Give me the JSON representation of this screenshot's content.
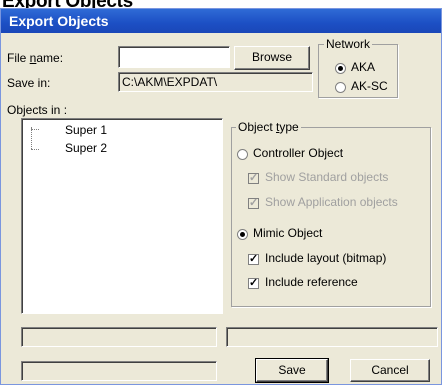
{
  "page_heading": "Export Objects",
  "window": {
    "title": "Export Objects"
  },
  "file": {
    "label_prefix": "File ",
    "label_accel": "n",
    "label_suffix": "ame:",
    "value": "",
    "browse_label": "Browse"
  },
  "save_in": {
    "label": "Save in:",
    "value": "C:\\AKM\\EXPDAT\\"
  },
  "network": {
    "title": "Network",
    "options": [
      {
        "label": "AKA",
        "selected": true
      },
      {
        "label": "AK-SC",
        "selected": false
      }
    ]
  },
  "objects_in": {
    "label": "Objects in :",
    "items": [
      "Super 1",
      "Super 2"
    ]
  },
  "object_type": {
    "title_prefix": "Object ",
    "title_accel": "t",
    "title_suffix": "ype",
    "controller": {
      "label": "Controller Object",
      "selected": false,
      "show_standard": {
        "label": "Show Standard objects",
        "checked": true,
        "enabled": false
      },
      "show_application": {
        "label": "Show Application objects",
        "checked": true,
        "enabled": false
      }
    },
    "mimic": {
      "label": "Mimic Object",
      "selected": true,
      "include_layout": {
        "label": "Include layout (bitmap)",
        "checked": true,
        "enabled": true
      },
      "include_reference": {
        "label": "Include reference",
        "checked": true,
        "enabled": true
      }
    }
  },
  "footer": {
    "save_label": "Save",
    "cancel_label": "Cancel"
  }
}
